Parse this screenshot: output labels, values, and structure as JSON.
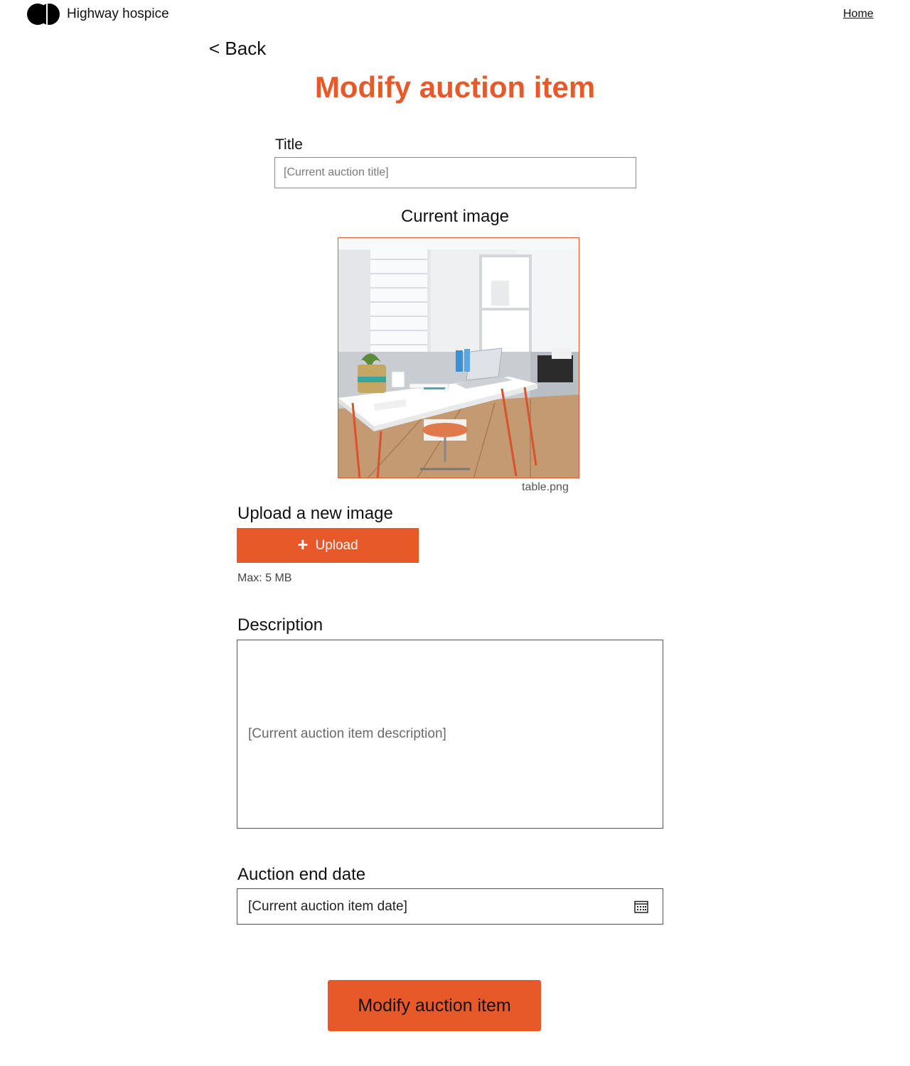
{
  "header": {
    "brand": "Highway hospice",
    "home_link": "Home"
  },
  "nav": {
    "back_label": "< Back"
  },
  "page": {
    "title": "Modify auction item"
  },
  "form": {
    "title_label": "Title",
    "title_placeholder": "[Current auction title]",
    "current_image_label": "Current image",
    "current_image_filename": "table.png",
    "upload_label": "Upload a new image",
    "upload_button": "Upload",
    "upload_max": "Max: 5 MB",
    "description_label": "Description",
    "description_value": "[Current auction item description]",
    "end_date_label": "Auction end date",
    "end_date_value": "[Current auction item date]",
    "submit_button": "Modify auction item"
  },
  "colors": {
    "accent": "#e8592a",
    "text": "#111111"
  },
  "icons": {
    "logo": "two-dots-logo-icon",
    "upload": "plus-icon",
    "calendar": "calendar-icon"
  }
}
